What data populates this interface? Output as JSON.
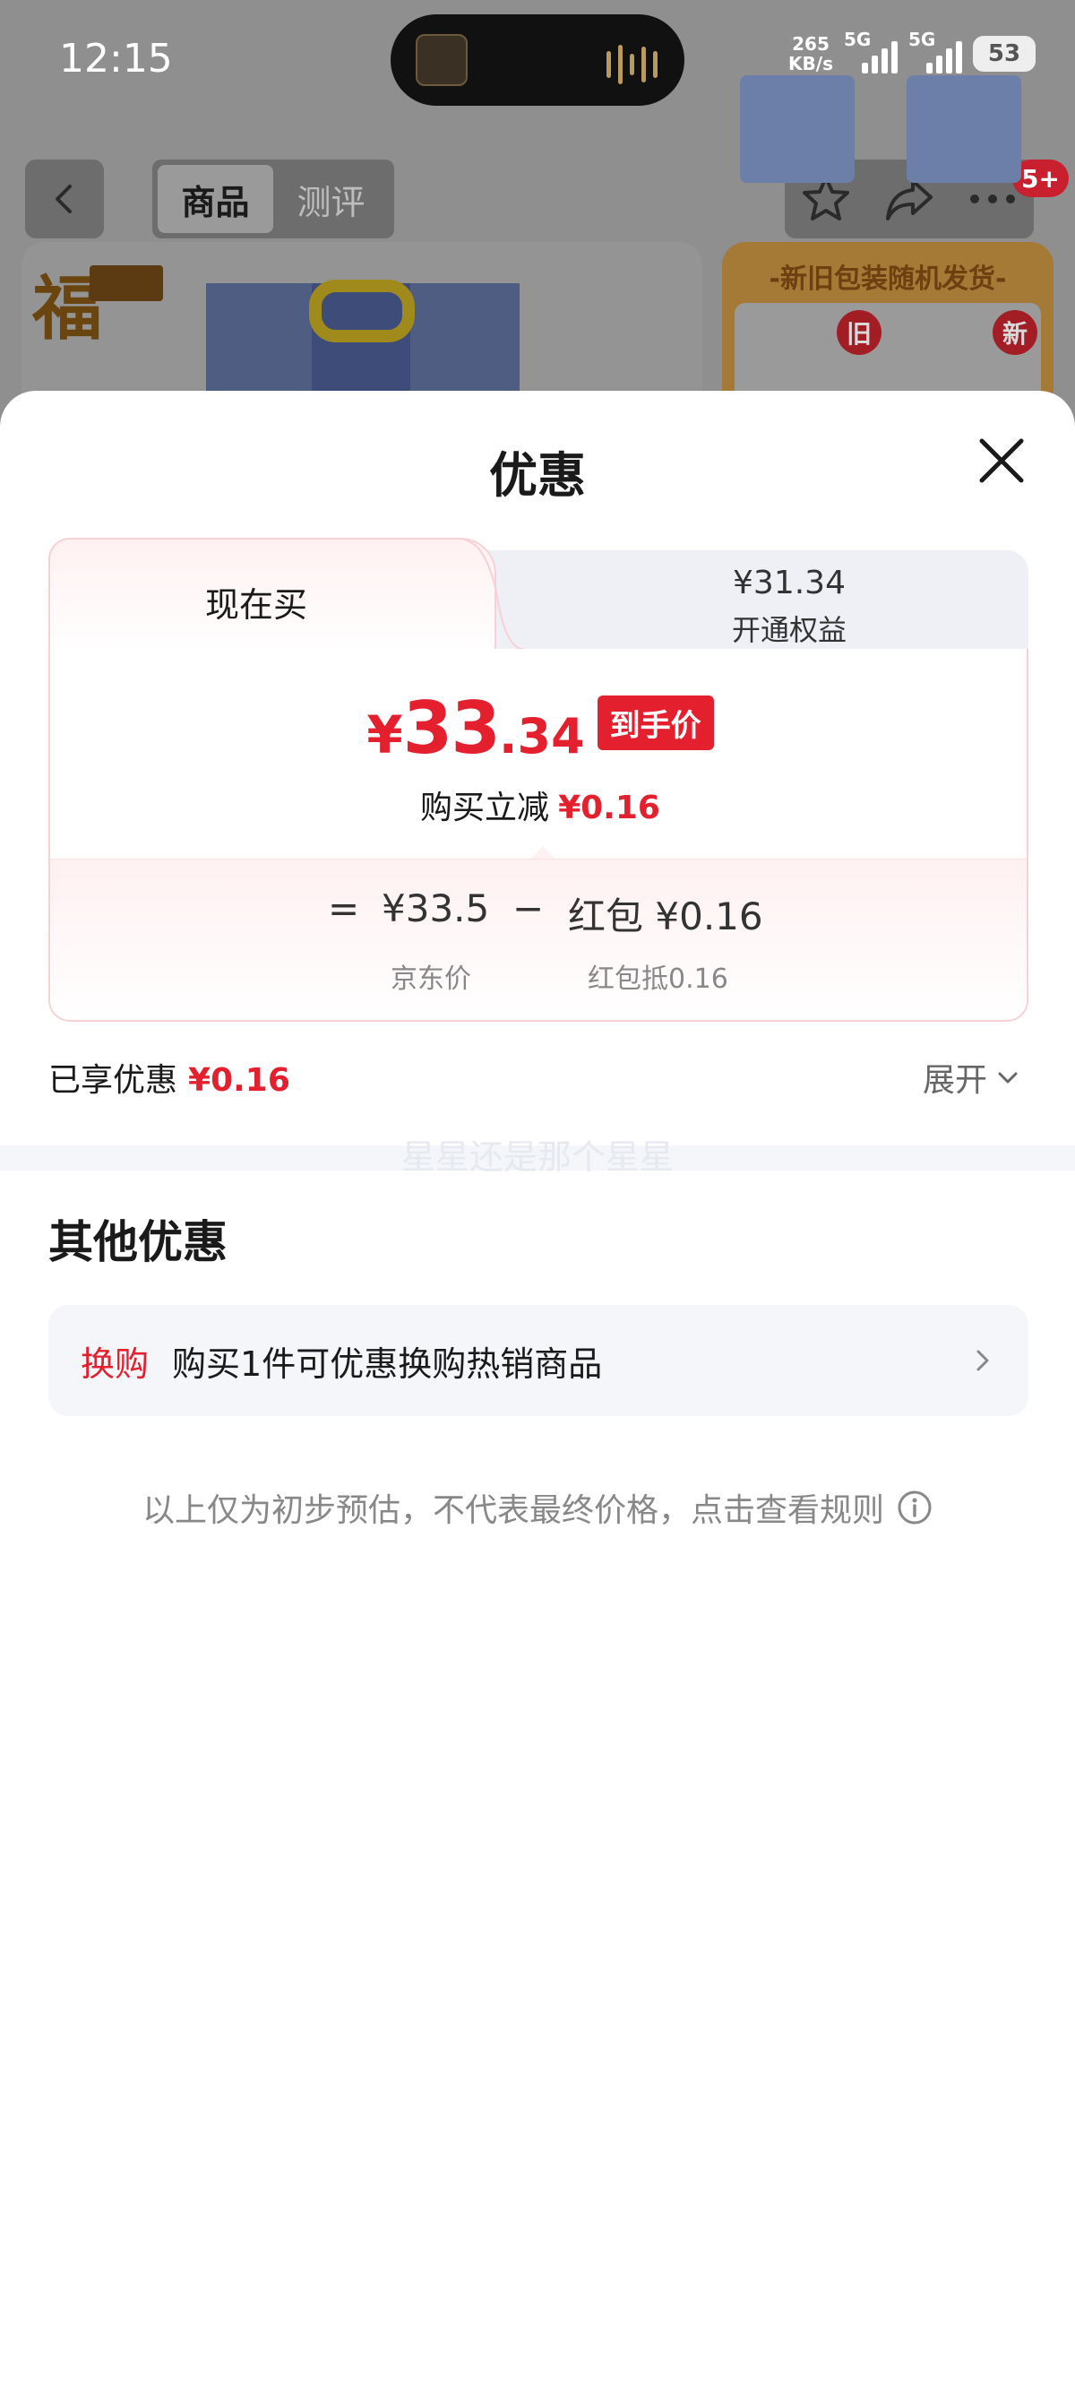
{
  "status_bar": {
    "time": "12:15",
    "net_speed_value": "265",
    "net_speed_unit": "KB/s",
    "signal_1_label": "5G",
    "signal_2_label": "5G",
    "battery": "53"
  },
  "background_page": {
    "tabs": [
      "商品",
      "测评"
    ],
    "active_tab": "商品",
    "cart_badge": "5+",
    "brand_logo_text": "福",
    "promo_title": "-新旧包装随机发货-",
    "package_old_tag": "旧",
    "package_new_tag": "新"
  },
  "sheet": {
    "title": "优惠",
    "tab_now_label": "现在买",
    "tab_alt_price": "¥31.34",
    "tab_alt_label": "开通权益",
    "final_price": {
      "currency": "¥",
      "integer": "33",
      "decimal": ".34",
      "tag": "到手价"
    },
    "reduce_text": "购买立减",
    "reduce_amount": "¥0.16",
    "breakdown": {
      "equals": "=",
      "jd_price": "¥33.5",
      "minus": "−",
      "hongbao_label": "红包",
      "hongbao_amount": "¥0.16",
      "jd_price_caption": "京东价",
      "hongbao_caption": "红包抵0.16"
    },
    "enjoyed_label": "已享优惠",
    "enjoyed_amount": "¥0.16",
    "expand_label": "展开",
    "watermark": "星星还是那个星星",
    "other_title": "其他优惠",
    "other_offer": {
      "tag": "换购",
      "text": "购买1件可优惠换购热销商品"
    },
    "disclaimer": "以上仅为初步预估，不代表最终价格，点击查看规则"
  }
}
